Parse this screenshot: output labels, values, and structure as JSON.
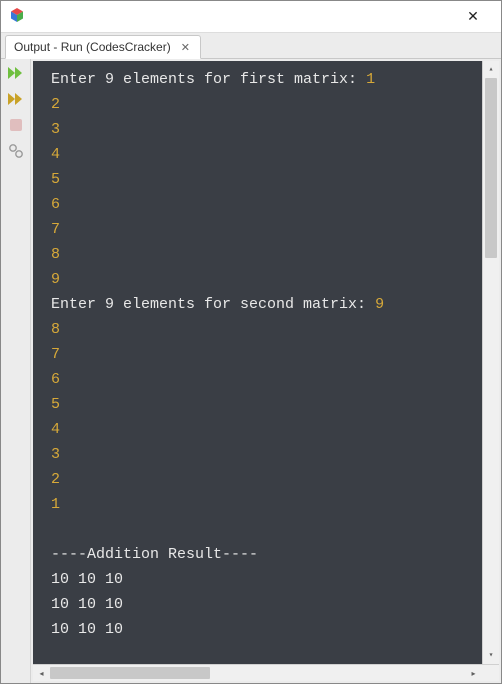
{
  "window": {
    "close_glyph": "✕"
  },
  "tab": {
    "label": "Output - Run (CodesCracker)",
    "close_glyph": "✕"
  },
  "console": {
    "prompt1": "Enter 9 elements for first matrix: ",
    "inputs1": [
      "1",
      "2",
      "3",
      "4",
      "5",
      "6",
      "7",
      "8",
      "9"
    ],
    "prompt2": "Enter 9 elements for second matrix: ",
    "inputs2": [
      "9",
      "8",
      "7",
      "6",
      "5",
      "4",
      "3",
      "2",
      "1"
    ],
    "blank": "",
    "result_header": "----Addition Result----",
    "result_rows": [
      "10 10 10",
      "10 10 10",
      "10 10 10"
    ]
  },
  "scroll": {
    "up": "▴",
    "down": "▾",
    "left": "◂",
    "right": "▸"
  }
}
